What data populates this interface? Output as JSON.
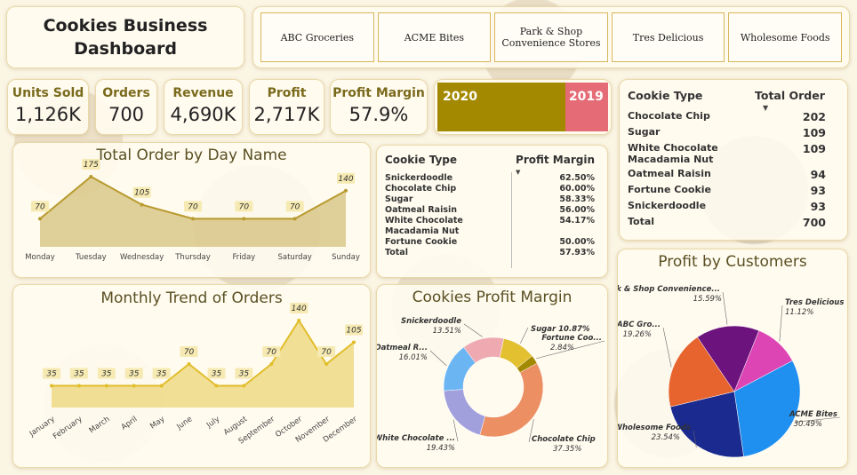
{
  "title": {
    "line1": "Cookies Business",
    "line2": "Dashboard"
  },
  "customers": [
    "ABC Groceries",
    "ACME Bites",
    "Park & Shop Convenience Stores",
    "Tres Delicious",
    "Wholesome Foods"
  ],
  "kpis": [
    {
      "label": "Units Sold",
      "value": "1,126K"
    },
    {
      "label": "Orders",
      "value": "700"
    },
    {
      "label": "Revenue",
      "value": "4,690K"
    },
    {
      "label": "Profit",
      "value": "2,717K"
    },
    {
      "label": "Profit Margin",
      "value": "57.9%"
    }
  ],
  "years": {
    "left": "2020",
    "right": "2019",
    "left_color": "#a38900",
    "right_color": "#e56c76"
  },
  "order_table": {
    "headers": [
      "Cookie Type",
      "Total Order"
    ],
    "rows": [
      [
        "Chocolate Chip",
        "202"
      ],
      [
        "Sugar",
        "109"
      ],
      [
        "White Chocolate Macadamia Nut",
        "109"
      ],
      [
        "Oatmeal Raisin",
        "94"
      ],
      [
        "Fortune Cookie",
        "93"
      ],
      [
        "Snickerdoodle",
        "93"
      ],
      [
        "Total",
        "700"
      ]
    ]
  },
  "margin_table": {
    "headers": [
      "Cookie Type",
      "Profit Margin"
    ],
    "rows": [
      [
        "Snickerdoodle",
        "62.50%"
      ],
      [
        "Chocolate Chip",
        "60.00%"
      ],
      [
        "Sugar",
        "58.33%"
      ],
      [
        "Oatmeal Raisin",
        "56.00%"
      ],
      [
        "White Chocolate Macadamia Nut",
        "54.17%"
      ],
      [
        "Fortune Cookie",
        "50.00%"
      ],
      [
        "Total",
        "57.93%"
      ]
    ]
  },
  "chart_data": [
    {
      "type": "area",
      "title": "Total Order by Day Name",
      "categories": [
        "Monday",
        "Tuesday",
        "Wednesday",
        "Thursday",
        "Friday",
        "Saturday",
        "Sunday"
      ],
      "values": [
        70,
        175,
        105,
        70,
        70,
        70,
        140
      ],
      "color": "#b89a2e"
    },
    {
      "type": "area",
      "title": "Monthly Trend of Orders",
      "categories": [
        "January",
        "February",
        "March",
        "April",
        "May",
        "June",
        "July",
        "August",
        "September",
        "October",
        "November",
        "December"
      ],
      "values": [
        35,
        35,
        35,
        35,
        35,
        70,
        35,
        35,
        70,
        140,
        70,
        105
      ],
      "color": "#e1bd2a"
    },
    {
      "type": "pie",
      "title": "Cookies Profit Margin",
      "donut": true,
      "slices": [
        {
          "label": "Sugar",
          "value": 10.87,
          "display": "Sugar 10.87%",
          "color": "#e2c02f"
        },
        {
          "label": "Fortune Coo...",
          "value": 2.84,
          "display": "2.84%",
          "color": "#a38900"
        },
        {
          "label": "Chocolate Chip",
          "value": 37.35,
          "display": "37.35%",
          "color": "#ec8f62"
        },
        {
          "label": "White Chocolate ...",
          "value": 19.43,
          "display": "19.43%",
          "color": "#a1a0dc"
        },
        {
          "label": "Oatmeal R...",
          "value": 16.01,
          "display": "16.01%",
          "color": "#6bb5f3"
        },
        {
          "label": "Snickerdoodle",
          "value": 13.51,
          "display": "13.51%",
          "color": "#efa9b0"
        }
      ]
    },
    {
      "type": "pie",
      "title": "Profit by Customers",
      "slices": [
        {
          "label": "Tres Delicious",
          "value": 11.12,
          "display": "11.12%",
          "color": "#dd45b4"
        },
        {
          "label": "ACME Bites",
          "value": 30.49,
          "display": "30.49%",
          "color": "#1f8ff0"
        },
        {
          "label": "Wholesome Foods",
          "value": 23.54,
          "display": "23.54%",
          "color": "#1a2a8e"
        },
        {
          "label": "ABC Gro...",
          "value": 19.26,
          "display": "19.26%",
          "color": "#e8642e"
        },
        {
          "label": "Park & Shop Convenience...",
          "value": 15.59,
          "display": "15.59%",
          "color": "#6c137e"
        }
      ]
    }
  ]
}
